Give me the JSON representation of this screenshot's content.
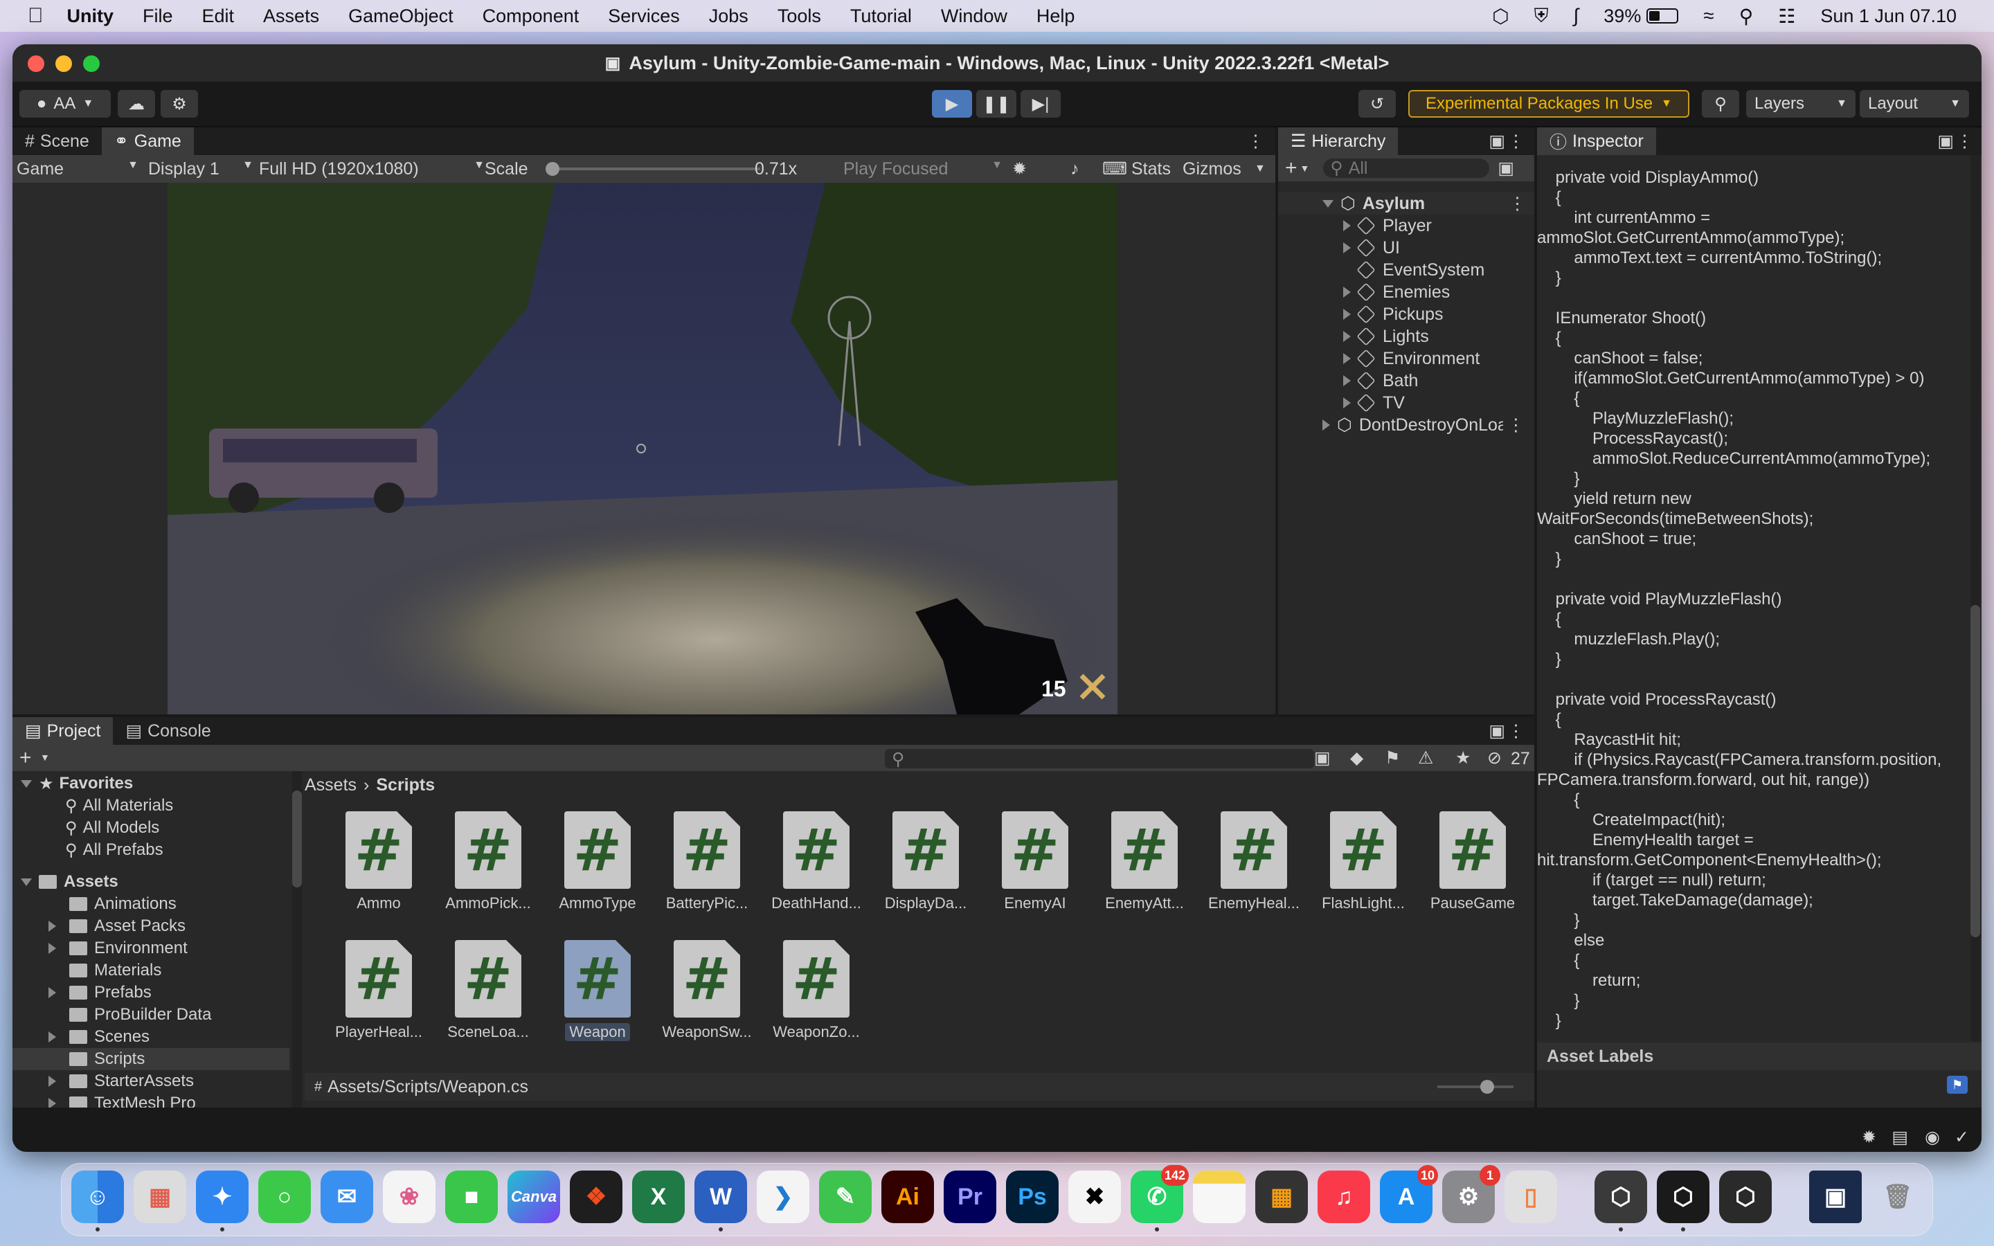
{
  "menubar": {
    "app": "Unity",
    "items": [
      "File",
      "Edit",
      "Assets",
      "GameObject",
      "Component",
      "Services",
      "Jobs",
      "Tools",
      "Tutorial",
      "Window",
      "Help"
    ],
    "battery": "39%",
    "datetime": "Sun 1 Jun  07.10"
  },
  "window": {
    "title": "Asylum - Unity-Zombie-Game-main - Windows, Mac, Linux - Unity 2022.3.22f1 <Metal>"
  },
  "toolbar": {
    "account": "AA",
    "experimental": "Experimental Packages In Use",
    "layers": "Layers",
    "layout": "Layout"
  },
  "gameview": {
    "tabs": [
      "Scene",
      "Game"
    ],
    "mode": "Game",
    "display": "Display 1",
    "resolution": "Full HD (1920x1080)",
    "scale_label": "Scale",
    "scale_value": "0.71x",
    "play_focused": "Play Focused",
    "stats": "Stats",
    "gizmos": "Gizmos",
    "ammo_count": "15"
  },
  "hierarchy": {
    "title": "Hierarchy",
    "search_placeholder": "All",
    "scene": "Asylum",
    "items": [
      "Player",
      "UI",
      "EventSystem",
      "Enemies",
      "Pickups",
      "Lights",
      "Environment",
      "Bath",
      "TV"
    ],
    "dontdestroy": "DontDestroyOnLoad"
  },
  "inspector": {
    "title": "Inspector",
    "code": "    private void DisplayAmmo()\n    {\n        int currentAmmo =\nammoSlot.GetCurrentAmmo(ammoType);\n        ammoText.text = currentAmmo.ToString();\n    }\n\n    IEnumerator Shoot()\n    {\n        canShoot = false;\n        if(ammoSlot.GetCurrentAmmo(ammoType) > 0)\n        {\n            PlayMuzzleFlash();\n            ProcessRaycast();\n            ammoSlot.ReduceCurrentAmmo(ammoType);\n        }\n        yield return new\nWaitForSeconds(timeBetweenShots);\n        canShoot = true;\n    }\n\n    private void PlayMuzzleFlash()\n    {\n        muzzleFlash.Play();\n    }\n\n    private void ProcessRaycast()\n    {\n        RaycastHit hit;\n        if (Physics.Raycast(FPCamera.transform.position,\nFPCamera.transform.forward, out hit, range))\n        {\n            CreateImpact(hit);\n            EnemyHealth target =\nhit.transform.GetComponent<EnemyHealth>();\n            if (target == null) return;\n            target.TakeDamage(damage);\n        }\n        else\n        {\n            return;\n        }\n    }",
    "asset_labels": "Asset Labels"
  },
  "project": {
    "tabs": [
      "Project",
      "Console"
    ],
    "hidden_count": "27",
    "favorites_label": "Favorites",
    "favorites": [
      "All Materials",
      "All Models",
      "All Prefabs"
    ],
    "assets_label": "Assets",
    "folders": [
      "Animations",
      "Asset Packs",
      "Environment",
      "Materials",
      "Prefabs",
      "ProBuilder Data",
      "Scenes",
      "Scripts",
      "StarterAssets",
      "TextMesh Pro"
    ],
    "breadcrumb": [
      "Assets",
      "Scripts"
    ],
    "scripts": [
      "Ammo",
      "AmmoPick...",
      "AmmoType",
      "BatteryPic...",
      "DeathHand...",
      "DisplayDa...",
      "EnemyAI",
      "EnemyAtt...",
      "EnemyHeal...",
      "FlashLight...",
      "PauseGame",
      "PlayerHeal...",
      "SceneLoa...",
      "Weapon",
      "WeaponSw...",
      "WeaponZo..."
    ],
    "selected_path": "Assets/Scripts/Weapon.cs"
  },
  "dock": {
    "whatsapp_badge": "142",
    "appstore_badge": "10",
    "settings_badge": "1",
    "labels": {
      "canva": "Canva",
      "ai": "Ai",
      "pr": "Pr",
      "ps": "Ps"
    }
  }
}
